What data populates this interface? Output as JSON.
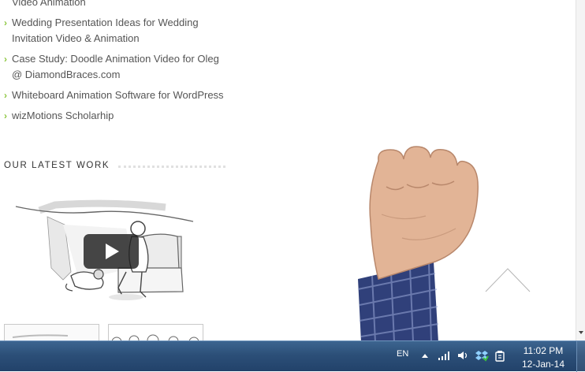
{
  "recent_posts": [
    {
      "title": "Video Animation"
    },
    {
      "title": "Wedding Presentation Ideas for Wedding Invitation Video & Animation"
    },
    {
      "title": "Case Study: Doodle Animation Video for Oleg @ DiamondBraces.com"
    },
    {
      "title": "Whiteboard Animation Software for WordPress"
    },
    {
      "title": "wizMotions Scholarhip"
    }
  ],
  "latest_work": {
    "title": "OUR LATEST WORK"
  },
  "taskbar": {
    "language": "EN",
    "time": "11:02 PM",
    "date": "12-Jan-14"
  },
  "icons": {
    "bullet": "chevron-right-icon",
    "play": "play-icon",
    "scroll_top": "chevron-up-icon",
    "tray": [
      "signal-icon",
      "volume-icon",
      "dropbox-icon",
      "power-icon"
    ]
  },
  "colors": {
    "bullet_arrow": "#8cc63f",
    "link_text": "#555555",
    "taskbar": "#2c4f78"
  }
}
